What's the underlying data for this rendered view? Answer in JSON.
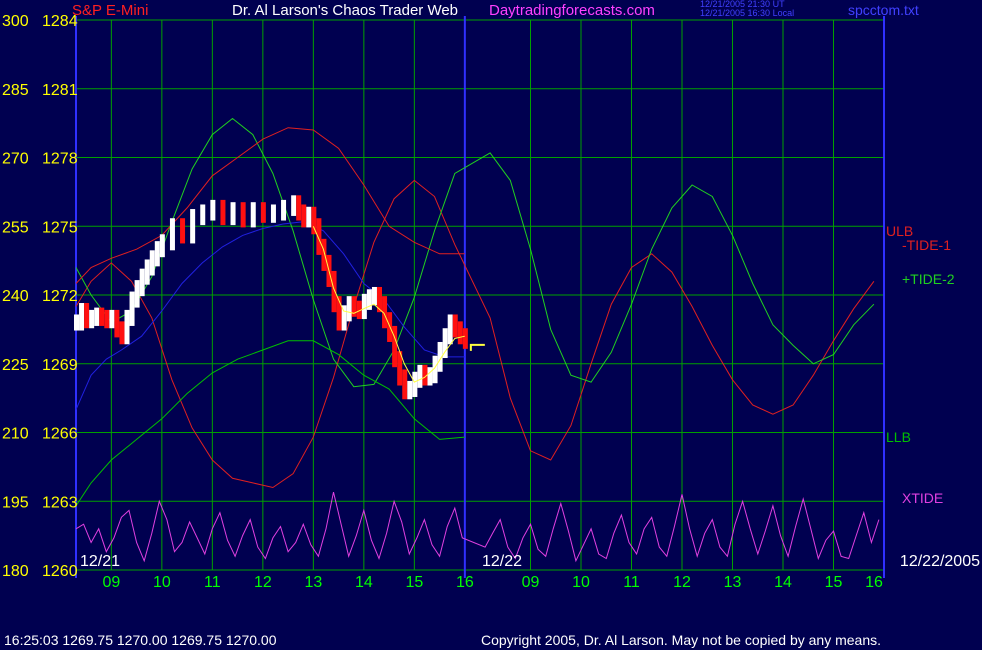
{
  "header": {
    "instrument": "S&P E-Mini",
    "title": "Dr. Al Larson's Chaos Trader Web",
    "site": "Daytradingforecasts.com",
    "time_ut": "12/21/2005 21:30 UT",
    "time_local": "12/21/2005 16:30 Local",
    "file": "spcctom.txt"
  },
  "footer": {
    "quote": "16:25:03   1269.75  1270.00  1269.75  1270.00",
    "copyright": "Copyright 2005, Dr. Al Larson. May not be copied by any means."
  },
  "colors": {
    "background": "#000050",
    "grid": "#00a000",
    "axis": "#3030ff",
    "price_up": "#ffffff",
    "price_down": "#ff1010",
    "ulb": "#e02020",
    "llb": "#00c000",
    "tide_minus1": "#e02020",
    "tide_plus2": "#20d020",
    "xtide": "#e040e0",
    "ma_blue": "#2020e0",
    "ma_yellow": "#ffff40",
    "left_axis_text": "#ffff00",
    "time_axis_text": "#00ff00",
    "header_text": "#ffffff",
    "header_red": "#ff2020",
    "header_site": "#ff40ff",
    "header_blue": "#4040ff"
  },
  "chart_data": {
    "type": "line",
    "left_scale_labels": [
      "300",
      "285",
      "270",
      "255",
      "240",
      "225",
      "210",
      "195",
      "180"
    ],
    "price_scale_labels": [
      "1284",
      "1281",
      "1278",
      "1275",
      "1272",
      "1269",
      "1266",
      "1263",
      "1260"
    ],
    "ylim_price": [
      1260,
      1284
    ],
    "ylim_left": [
      180,
      300
    ],
    "time_labels": [
      "09",
      "10",
      "11",
      "12",
      "13",
      "14",
      "15",
      "16",
      "09",
      "10",
      "11",
      "12",
      "13",
      "14",
      "15",
      "16"
    ],
    "xlim": [
      8.3,
      16.0
    ],
    "date_labels": [
      "12/21",
      "12/22",
      "12/22/2005"
    ],
    "grid": true,
    "series_labels": [
      "ULB",
      "-TIDE-1",
      "+TIDE-2",
      "LLB",
      "XTIDE"
    ],
    "series": [
      {
        "name": "price",
        "x": [
          8.3,
          8.4,
          8.5,
          8.6,
          8.7,
          8.8,
          8.9,
          9.0,
          9.1,
          9.2,
          9.3,
          9.4,
          9.5,
          9.6,
          9.7,
          9.8,
          9.9,
          10.0,
          10.2,
          10.4,
          10.6,
          10.8,
          11.0,
          11.2,
          11.4,
          11.6,
          11.8,
          12.0,
          12.2,
          12.4,
          12.6,
          12.7,
          12.8,
          12.9,
          13.0,
          13.1,
          13.2,
          13.3,
          13.4,
          13.5,
          13.6,
          13.7,
          13.8,
          13.9,
          14.0,
          14.1,
          14.2,
          14.3,
          14.4,
          14.5,
          14.6,
          14.7,
          14.8,
          14.9,
          15.0,
          15.1,
          15.2,
          15.3,
          15.4,
          15.5,
          15.6,
          15.7,
          15.8,
          15.9,
          16.0
        ],
        "values": [
          1270.8,
          1271.3,
          1270.9,
          1271.0,
          1271.1,
          1271.0,
          1270.9,
          1271.0,
          1270.5,
          1270.2,
          1271.0,
          1271.8,
          1272.3,
          1272.8,
          1273.2,
          1273.6,
          1274.0,
          1274.3,
          1275.0,
          1274.6,
          1275.4,
          1275.6,
          1275.8,
          1275.4,
          1275.7,
          1275.3,
          1275.7,
          1275.5,
          1275.6,
          1275.8,
          1276.0,
          1275.6,
          1275.3,
          1275.5,
          1275.0,
          1274.1,
          1273.4,
          1272.7,
          1271.6,
          1270.8,
          1271.2,
          1271.6,
          1271.4,
          1271.3,
          1271.7,
          1271.9,
          1272.0,
          1271.6,
          1270.9,
          1270.3,
          1269.2,
          1268.4,
          1267.8,
          1267.9,
          1268.3,
          1268.6,
          1268.4,
          1268.5,
          1269.0,
          1269.6,
          1270.2,
          1270.8,
          1270.5,
          1270.2,
          1270.0
        ]
      },
      {
        "name": "ma_yellow",
        "x": [
          13.0,
          13.2,
          13.4,
          13.6,
          13.8,
          14.0,
          14.2,
          14.4,
          14.6,
          14.8,
          15.0,
          15.2,
          15.4,
          15.6,
          15.8,
          16.0
        ],
        "values": [
          1275.0,
          1274.0,
          1272.3,
          1271.3,
          1271.2,
          1271.4,
          1271.6,
          1271.2,
          1270.2,
          1269.0,
          1268.2,
          1268.4,
          1268.8,
          1269.5,
          1270.1,
          1270.2
        ]
      },
      {
        "name": "ma_blue",
        "x": [
          8.3,
          8.6,
          8.9,
          9.2,
          9.6,
          10.0,
          10.4,
          10.8,
          11.2,
          11.6,
          12.0,
          12.4,
          12.8,
          13.2,
          13.6,
          14.0,
          14.4,
          14.8,
          15.2,
          15.6,
          16.0
        ],
        "values": [
          1267.0,
          1268.5,
          1269.2,
          1269.6,
          1270.2,
          1271.3,
          1272.5,
          1273.4,
          1274.1,
          1274.6,
          1274.9,
          1275.1,
          1275.2,
          1274.8,
          1273.8,
          1272.5,
          1271.8,
          1270.6,
          1269.6,
          1269.3,
          1269.3
        ]
      },
      {
        "name": "ULB",
        "x": [
          8.3,
          8.6,
          9.0,
          9.5,
          10.0,
          10.5,
          11.0,
          11.5,
          12.0,
          12.5,
          13.0,
          13.5,
          14.0,
          14.5,
          15.0,
          15.5,
          16.0
        ],
        "values": [
          1272.5,
          1273.2,
          1273.6,
          1274.0,
          1274.6,
          1275.8,
          1277.2,
          1278.0,
          1278.8,
          1279.3,
          1279.2,
          1278.4,
          1276.8,
          1275.0,
          1274.3,
          1273.8,
          1273.8
        ]
      },
      {
        "name": "LLB",
        "x": [
          8.3,
          8.6,
          9.0,
          9.5,
          10.0,
          10.5,
          11.0,
          11.5,
          12.0,
          12.5,
          13.0,
          13.5,
          14.0,
          14.5,
          15.0,
          15.5,
          16.0
        ],
        "values": [
          1262.8,
          1263.8,
          1264.8,
          1265.7,
          1266.6,
          1267.7,
          1268.6,
          1269.2,
          1269.6,
          1270.0,
          1270.0,
          1269.4,
          1268.5,
          1267.9,
          1266.6,
          1265.7,
          1265.8
        ]
      },
      {
        "name": "-TIDE-1",
        "x": [
          8.3,
          8.6,
          9.0,
          9.4,
          9.8,
          10.2,
          10.6,
          11.0,
          11.4,
          11.8,
          12.2,
          12.6,
          13.0,
          13.4,
          13.8,
          14.2,
          14.6,
          15.0,
          15.4,
          15.8,
          16.2,
          16.6,
          17.0,
          17.4,
          17.8,
          18.2,
          18.6,
          19.0,
          19.4,
          19.8,
          20.2,
          20.6,
          21.0,
          21.4,
          21.8,
          22.2,
          22.6,
          23.0,
          23.4,
          23.8
        ],
        "values": [
          1271.5,
          1272.6,
          1273.4,
          1272.6,
          1271.0,
          1268.3,
          1266.2,
          1264.8,
          1264.0,
          1263.8,
          1263.6,
          1264.2,
          1265.8,
          1268.4,
          1271.5,
          1274.3,
          1276.2,
          1277.0,
          1276.3,
          1274.2,
          1271.0,
          1267.5,
          1265.2,
          1264.8,
          1266.3,
          1269.0,
          1271.6,
          1273.2,
          1273.8,
          1273.0,
          1271.5,
          1269.8,
          1268.3,
          1267.2,
          1266.8,
          1267.2,
          1268.5,
          1270.0,
          1271.4,
          1272.6
        ]
      },
      {
        "name": "+TIDE-2",
        "x": [
          8.3,
          8.6,
          9.0,
          9.4,
          9.8,
          10.2,
          10.6,
          11.0,
          11.4,
          11.8,
          12.2,
          12.6,
          13.0,
          13.4,
          13.8,
          14.2,
          14.6,
          15.0,
          15.4,
          15.8,
          16.2,
          16.6,
          17.0,
          17.4,
          17.8,
          18.2,
          18.6,
          19.0,
          19.4,
          19.8,
          20.2,
          20.6,
          21.0,
          21.4,
          21.8,
          22.2,
          22.6,
          23.0,
          23.4,
          23.8
        ],
        "values": [
          1273.2,
          1272.0,
          1270.8,
          1271.3,
          1272.8,
          1275.2,
          1277.5,
          1279.0,
          1279.7,
          1279.0,
          1277.3,
          1274.8,
          1271.8,
          1269.2,
          1268.0,
          1268.1,
          1269.6,
          1271.9,
          1274.8,
          1277.3,
          1278.2,
          1277.0,
          1274.0,
          1270.5,
          1268.5,
          1268.2,
          1269.5,
          1271.6,
          1274.0,
          1275.8,
          1276.8,
          1276.3,
          1274.6,
          1272.5,
          1270.7,
          1269.8,
          1269.0,
          1269.4,
          1270.7,
          1271.6
        ]
      },
      {
        "name": "XTIDE",
        "x": [
          8.3,
          8.45,
          8.6,
          8.75,
          8.9,
          9.05,
          9.2,
          9.35,
          9.5,
          9.65,
          9.8,
          9.95,
          10.1,
          10.25,
          10.4,
          10.55,
          10.7,
          10.85,
          11.0,
          11.15,
          11.3,
          11.45,
          11.6,
          11.75,
          11.9,
          12.05,
          12.2,
          12.35,
          12.5,
          12.65,
          12.8,
          12.95,
          13.1,
          13.25,
          13.4,
          13.55,
          13.7,
          13.85,
          14.0,
          14.15,
          14.3,
          14.45,
          14.6,
          14.75,
          14.9,
          15.05,
          15.2,
          15.35,
          15.5,
          15.65,
          15.8,
          15.95,
          16.1,
          16.25,
          16.4,
          16.55,
          16.7,
          16.85,
          17.0,
          17.15,
          17.3,
          17.45,
          17.6,
          17.75,
          17.9,
          18.05,
          18.2,
          18.35,
          18.5,
          18.65,
          18.8,
          18.95,
          19.1,
          19.25,
          19.4,
          19.55,
          19.7,
          19.85,
          20.0,
          20.15,
          20.3,
          20.45,
          20.6,
          20.75,
          20.9,
          21.05,
          21.2,
          21.35,
          21.5,
          21.65,
          21.8,
          21.95,
          22.1,
          22.25,
          22.4,
          22.55,
          22.7,
          22.85,
          23.0,
          23.15,
          23.3,
          23.45,
          23.6,
          23.75,
          23.9
        ],
        "values": [
          1261.8,
          1262.0,
          1261.2,
          1261.8,
          1260.8,
          1261.4,
          1262.3,
          1262.6,
          1261.2,
          1260.4,
          1261.6,
          1263.0,
          1262.2,
          1260.8,
          1261.2,
          1262.1,
          1261.4,
          1260.7,
          1261.8,
          1262.5,
          1261.3,
          1260.6,
          1261.5,
          1262.2,
          1261.0,
          1260.5,
          1261.4,
          1261.9,
          1260.8,
          1261.2,
          1262.0,
          1261.1,
          1260.6,
          1261.8,
          1263.4,
          1262.0,
          1260.6,
          1261.5,
          1262.6,
          1261.3,
          1260.5,
          1261.6,
          1263.0,
          1262.1,
          1260.7,
          1261.4,
          1262.2,
          1261.1,
          1260.6,
          1261.9,
          1262.7,
          1261.4,
          1261.0,
          1261.6,
          1262.2,
          1261.0,
          1260.5,
          1261.4,
          1262.0,
          1260.9,
          1260.6,
          1261.8,
          1262.9,
          1261.7,
          1260.4,
          1261.1,
          1261.8,
          1260.7,
          1260.5,
          1261.6,
          1262.4,
          1261.2,
          1260.7,
          1261.8,
          1262.3,
          1261.0,
          1260.6,
          1261.9,
          1263.3,
          1261.8,
          1260.6,
          1261.6,
          1262.2,
          1261.0,
          1260.6,
          1262.0,
          1263.0,
          1261.8,
          1260.7,
          1261.7,
          1262.8,
          1261.5,
          1260.6,
          1261.9,
          1263.1,
          1261.8,
          1260.5,
          1261.3,
          1261.7,
          1260.6,
          1260.5,
          1261.5,
          1262.5,
          1261.2,
          1262.2
        ]
      }
    ]
  }
}
